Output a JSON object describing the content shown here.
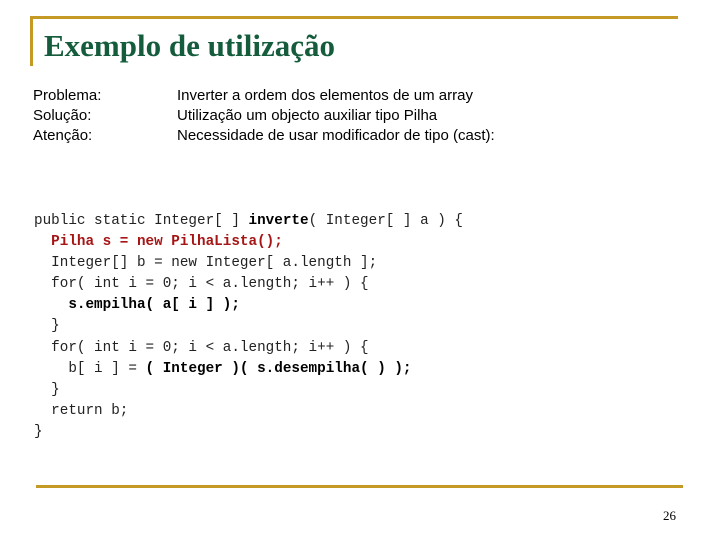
{
  "title": "Exemplo de utilização",
  "info": [
    {
      "label": "Problema:",
      "value": "Inverter a ordem dos elementos de um array"
    },
    {
      "label": "Solução:",
      "value": "Utilização um objecto auxiliar tipo Pilha"
    },
    {
      "label": "Atenção:",
      "value": "Necessidade de usar modificador de tipo (cast):"
    }
  ],
  "code": {
    "l1a": "public static Integer[ ] ",
    "l1b": "inverte",
    "l1c": "( Integer[ ] a ) {",
    "l2": "  Pilha s = new PilhaLista();",
    "l3": "  Integer[] b = new Integer[ a.length ];",
    "l4": "  for( int i = 0; i < a.length; i++ ) {",
    "l5": "    s.empilha( a[ i ] );",
    "l6": "  }",
    "l7": "  for( int i = 0; i < a.length; i++ ) {",
    "l8a": "    b[ i ] = ",
    "l8b": "( Integer )( s.desempilha( ) );",
    "l9": "  }",
    "l10": "  return b;",
    "l11": "}"
  },
  "page_number": "26",
  "colors": {
    "accent": "#c49a24",
    "title": "#145c3c",
    "highlight": "#a51515"
  }
}
